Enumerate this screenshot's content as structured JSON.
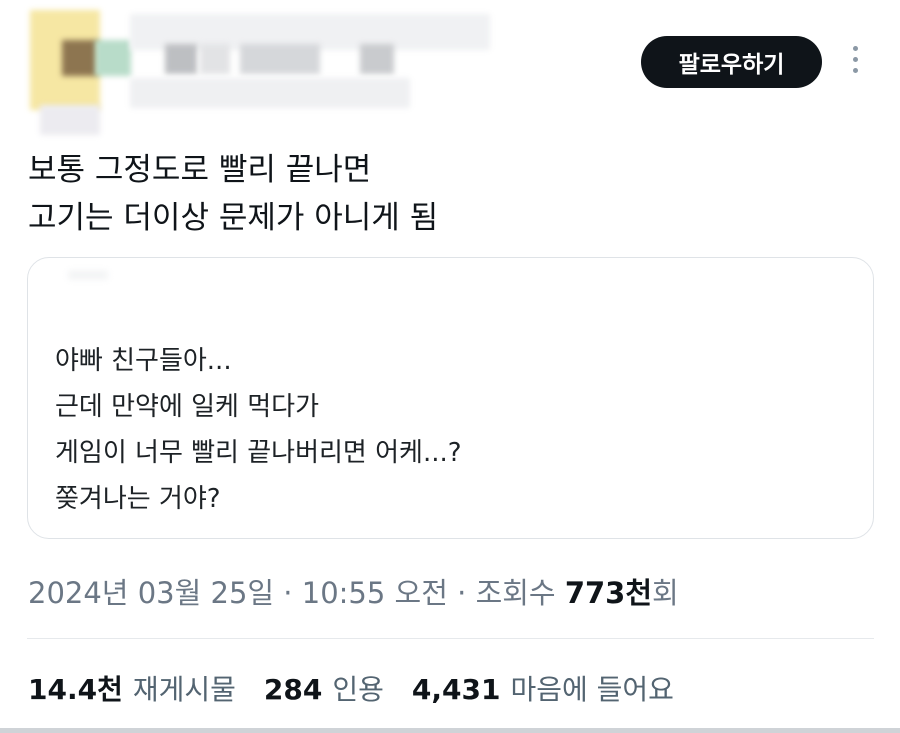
{
  "header": {
    "follow_label": "팔로우하기",
    "more_icon": "more-vertical-icon"
  },
  "tweet": {
    "lines": [
      "보통 그정도로 빨리 끝나면",
      "고기는 더이상 문제가 아니게 됨"
    ]
  },
  "quote": {
    "lines": [
      "야빠 친구들아...",
      "근데 만약에 일케 먹다가",
      "게임이 너무 빨리 끝나버리면 어케...?",
      "쫒겨나는 거야?"
    ]
  },
  "meta": {
    "date": "2024년 03월 25일",
    "sep1": " · ",
    "time": "10:55 오전",
    "sep2": " · ",
    "views_prefix": "조회수 ",
    "views_value": "773천",
    "views_suffix": "회"
  },
  "stats": {
    "reposts_value": "14.4천",
    "reposts_label": "재게시물",
    "quotes_value": "284",
    "quotes_label": "인용",
    "likes_value": "4,431",
    "likes_label": "마음에 들어요"
  },
  "colors": {
    "follow_bg": "#0f1419",
    "muted_text": "#6b7785",
    "border": "#dfe3e7"
  }
}
